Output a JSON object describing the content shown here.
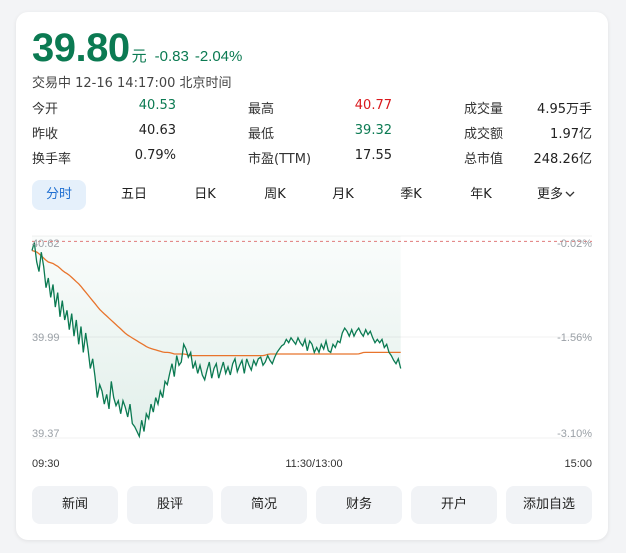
{
  "quote": {
    "price": "39.80",
    "unit": "元",
    "change": "-0.83",
    "change_pct": "-2.04%",
    "status": "交易中 12-16 14:17:00 北京时间"
  },
  "stats": [
    [
      {
        "label": "今开",
        "value": "40.53",
        "tone": "green"
      },
      {
        "label": "最高",
        "value": "40.77",
        "tone": "red"
      },
      {
        "label": "成交量",
        "value": "4.95万手",
        "tone": ""
      }
    ],
    [
      {
        "label": "昨收",
        "value": "40.63",
        "tone": ""
      },
      {
        "label": "最低",
        "value": "39.32",
        "tone": "green"
      },
      {
        "label": "成交额",
        "value": "1.97亿",
        "tone": ""
      }
    ],
    [
      {
        "label": "换手率",
        "value": "0.79%",
        "tone": ""
      },
      {
        "label": "市盈(TTM)",
        "value": "17.55",
        "tone": ""
      },
      {
        "label": "总市值",
        "value": "248.26亿",
        "tone": ""
      }
    ]
  ],
  "tabs": [
    "分时",
    "五日",
    "日K",
    "周K",
    "月K",
    "季K",
    "年K",
    "更多"
  ],
  "active_tab": 0,
  "buttons": [
    "新闻",
    "股评",
    "简况",
    "财务",
    "开户",
    "添加自选"
  ],
  "colors": {
    "down": "#0b7a52",
    "up": "#d9181c",
    "avg_line": "#e8742c",
    "accent": "#1f6fd1"
  },
  "chart_data": {
    "type": "line",
    "y_left_ticks": [
      "40.62",
      "39.99",
      "39.37"
    ],
    "y_right_ticks": [
      "-0.02%",
      "-1.56%",
      "-3.10%"
    ],
    "x_ticks": [
      "09:30",
      "11:30/13:00",
      "15:00"
    ],
    "ylim": [
      39.37,
      40.62
    ],
    "prev_close": 40.63,
    "x_range": [
      0,
      240
    ],
    "series": [
      {
        "role": "price",
        "values": [
          40.53,
          40.58,
          40.46,
          40.4,
          40.52,
          40.43,
          40.3,
          40.36,
          40.24,
          40.32,
          40.18,
          40.27,
          40.12,
          40.22,
          40.1,
          40.16,
          40.04,
          40.14,
          40.0,
          40.1,
          39.95,
          40.06,
          39.9,
          40.02,
          39.92,
          39.8,
          39.86,
          39.75,
          39.62,
          39.7,
          39.66,
          39.58,
          39.64,
          39.55,
          39.72,
          39.62,
          39.57,
          39.6,
          39.52,
          39.6,
          39.56,
          39.5,
          39.58,
          39.46,
          39.44,
          39.41,
          39.38,
          39.48,
          39.41,
          39.52,
          39.49,
          39.58,
          39.53,
          39.62,
          39.58,
          39.66,
          39.62,
          39.72,
          39.7,
          39.77,
          39.83,
          39.75,
          39.88,
          39.82,
          39.84,
          39.95,
          39.92,
          39.87,
          39.9,
          39.8,
          39.84,
          39.77,
          39.82,
          39.76,
          39.73,
          39.79,
          39.84,
          39.74,
          39.8,
          39.83,
          39.74,
          39.79,
          39.84,
          39.77,
          39.81,
          39.76,
          39.83,
          39.86,
          39.78,
          39.82,
          39.85,
          39.77,
          39.86,
          39.82,
          39.79,
          39.85,
          39.82,
          39.86,
          39.87,
          39.82,
          39.84,
          39.88,
          39.85,
          39.83,
          39.87,
          39.9,
          39.92,
          39.94,
          39.95,
          39.98,
          39.96,
          39.99,
          39.97,
          39.95,
          39.99,
          39.96,
          39.94,
          39.98,
          39.91,
          39.97,
          39.95,
          39.9,
          39.93,
          39.9,
          39.95,
          39.92,
          39.97,
          39.91,
          39.9,
          39.95,
          39.93,
          39.97,
          39.96,
          40.02,
          40.05,
          40.03,
          40.0,
          40.04,
          40.0,
          40.03,
          40.05,
          40.02,
          40.0,
          40.04,
          40.01,
          40.03,
          39.99,
          39.96,
          39.98,
          39.96,
          39.98,
          39.93,
          39.95,
          39.9,
          39.88,
          39.85,
          39.83,
          39.86,
          39.8
        ]
      },
      {
        "role": "avg",
        "values": [
          40.53,
          40.52,
          40.49,
          40.46,
          40.45,
          40.43,
          40.4,
          40.38,
          40.35,
          40.32,
          40.28,
          40.24,
          40.2,
          40.16,
          40.13,
          40.1,
          40.07,
          40.04,
          40.01,
          39.99,
          39.97,
          39.95,
          39.93,
          39.92,
          39.91,
          39.9,
          39.9,
          39.89,
          39.89,
          39.89,
          39.88,
          39.88,
          39.88,
          39.88,
          39.88,
          39.88,
          39.88,
          39.88,
          39.88,
          39.88,
          39.88,
          39.88,
          39.88,
          39.88,
          39.88,
          39.89,
          39.89,
          39.89,
          39.89,
          39.89,
          39.89,
          39.89,
          39.89,
          39.89,
          39.89,
          39.89,
          39.89,
          39.89,
          39.89,
          39.89,
          39.89,
          39.89,
          39.89,
          39.9,
          39.9,
          39.9,
          39.9,
          39.9,
          39.9,
          39.9,
          39.9
        ]
      }
    ]
  }
}
